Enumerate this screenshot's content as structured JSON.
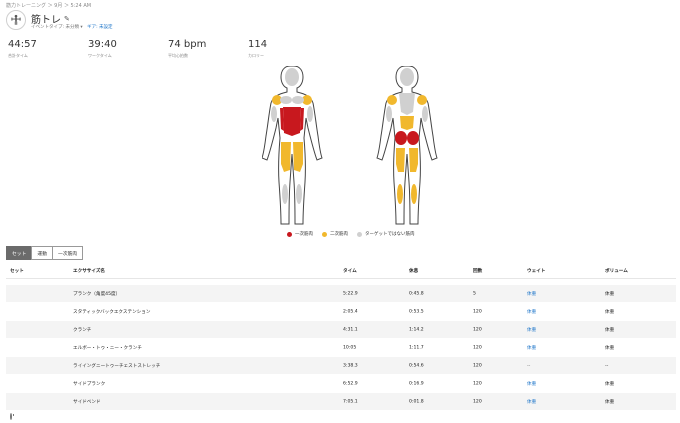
{
  "header": {
    "breadcrumb": "筋力トレーニング ＞ 9月 ＞ 5:24 AM",
    "title": "筋トレ",
    "subtitle": "イベントタイプ: 未分類 ▾",
    "edit_label": "ギア: 未設定"
  },
  "stats": [
    {
      "value": "44:57",
      "label": "合計タイム"
    },
    {
      "value": "39:40",
      "label": "ワークタイム"
    },
    {
      "value": "74 bpm",
      "label": "平均心拍数"
    },
    {
      "value": "114",
      "label": "カロリー"
    }
  ],
  "legend": {
    "primary": "一次筋肉",
    "secondary": "二次筋肉",
    "not_targeted": "ターゲットではない筋肉",
    "primary_color": "#c8181e",
    "secondary_color": "#f1b82d",
    "neutral_color": "#d0d0d0"
  },
  "tabs": [
    "セット",
    "運動",
    "一次筋肉"
  ],
  "table": {
    "columns": [
      "セット",
      "エクササイズ名",
      "タイム",
      "休息",
      "回数",
      "ウェイト",
      "ボリューム"
    ],
    "rows": [
      {
        "name": "プランク（角度45度）",
        "time": "5:22.9",
        "rest": "0:45.8",
        "reps": "5",
        "weight": "体重",
        "volume": "体重"
      },
      {
        "name": "スタティックバックエクステンション",
        "time": "2:05.4",
        "rest": "0:53.5",
        "reps": "120",
        "weight": "体重",
        "volume": "体重"
      },
      {
        "name": "クランチ",
        "time": "4:31.1",
        "rest": "1:14.2",
        "reps": "120",
        "weight": "体重",
        "volume": "体重"
      },
      {
        "name": "エルボー・トゥ・ニー・クランチ",
        "time": "10:05",
        "rest": "1:11.7",
        "reps": "120",
        "weight": "体重",
        "volume": "体重"
      },
      {
        "name": "ライイングニートゥーチェストストレッチ",
        "time": "3:38.3",
        "rest": "0:54.6",
        "reps": "120",
        "weight": "--",
        "volume": "--"
      },
      {
        "name": "サイドプランク",
        "time": "6:52.9",
        "rest": "0:16.9",
        "reps": "120",
        "weight": "体重",
        "volume": "体重"
      },
      {
        "name": "サイドベンド",
        "time": "7:05.1",
        "rest": "0:01.8",
        "reps": "120",
        "weight": "体重",
        "volume": "体重"
      }
    ]
  }
}
